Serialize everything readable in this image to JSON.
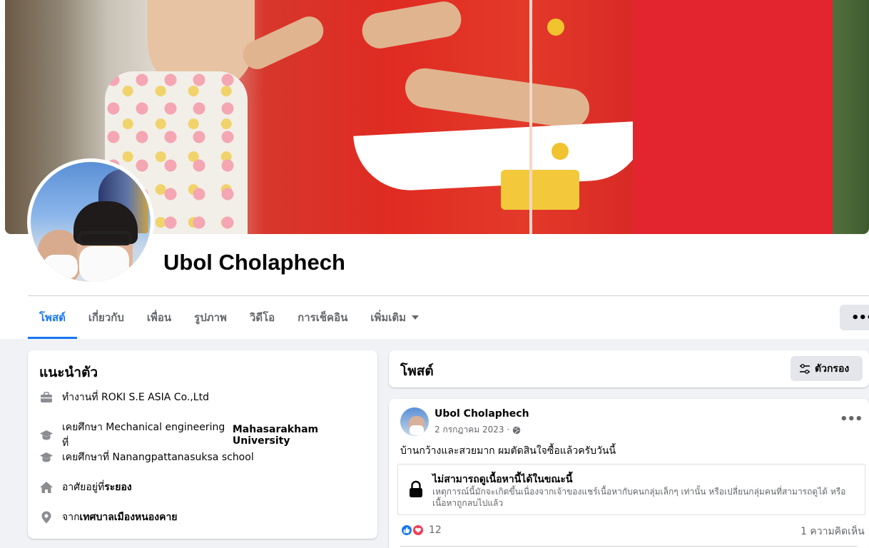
{
  "profile": {
    "name": "Ubol Cholaphech"
  },
  "tabs": [
    {
      "label": "โพสต์",
      "active": true
    },
    {
      "label": "เกี่ยวกับ",
      "active": false
    },
    {
      "label": "เพื่อน",
      "active": false
    },
    {
      "label": "รูปภาพ",
      "active": false
    },
    {
      "label": "วิดีโอ",
      "active": false
    },
    {
      "label": "การเช็คอิน",
      "active": false
    },
    {
      "label": "เพิ่มเติม",
      "active": false
    }
  ],
  "more_button": {
    "label": "•••"
  },
  "intro": {
    "title": "แนะนำตัว",
    "items": [
      {
        "icon": "briefcase-icon",
        "prefix": "ทำงานที่ ROKI S.E ASIA Co.,Ltd",
        "bold": "",
        "suffix": ""
      },
      {
        "icon": "graduation-cap-icon",
        "prefix": "เคยศึกษา Mechanical engineering ที่ ",
        "bold": "Mahasarakham University",
        "suffix": ""
      },
      {
        "icon": "graduation-cap-icon",
        "prefix": "เคยศึกษาที่ Nanangpattanasuksa school",
        "bold": "",
        "suffix": ""
      },
      {
        "icon": "home-icon",
        "prefix": "อาศัยอยู่ที่ ",
        "bold": "ระยอง",
        "suffix": ""
      },
      {
        "icon": "location-pin-icon",
        "prefix": "จาก ",
        "bold": "เทศบาลเมืองหนองคาย",
        "suffix": ""
      }
    ]
  },
  "posts_header": {
    "title": "โพสต์",
    "filter_label": "ตัวกรอง"
  },
  "post": {
    "author": "Ubol Cholaphech",
    "date": "2 กรกฎาคม 2023 ·",
    "privacy_icon": "globe-icon",
    "more_label": "•••",
    "text": "บ้านกว้างและสวยมาก ผมตัดสินใจซื้อแล้วครับวันนี้",
    "unavailable": {
      "title": "ไม่สามารถดูเนื้อหานี้ได้ในขณะนี้",
      "description": "เหตุการณ์นี้มักจะเกิดขึ้นเนื่องจากเจ้าของแชร์เนื้อหากับคนกลุ่มเล็กๆ เท่านั้น หรือเปลี่ยนกลุ่มคนที่สามารถดูได้ หรือเนื้อหาถูกลบไปแล้ว"
    },
    "reaction_count": "12",
    "comments": "1 ความคิดเห็น"
  },
  "colors": {
    "accent": "#1877f2",
    "background": "#f0f2f5",
    "secondary_text": "#65676b"
  }
}
